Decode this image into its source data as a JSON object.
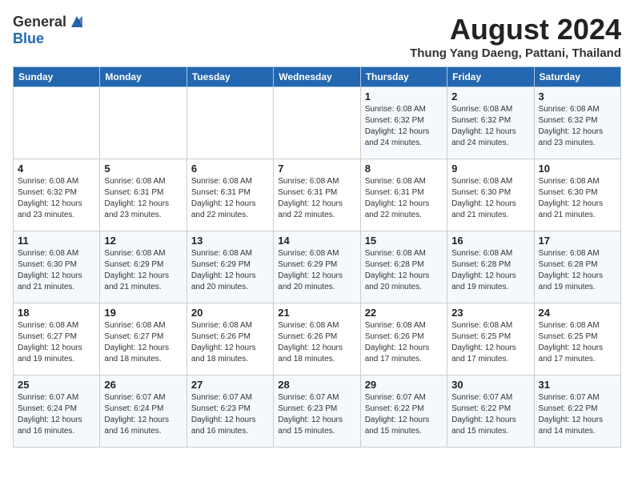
{
  "header": {
    "logo_line1": "General",
    "logo_line2": "Blue",
    "month_year": "August 2024",
    "location": "Thung Yang Daeng, Pattani, Thailand"
  },
  "days_of_week": [
    "Sunday",
    "Monday",
    "Tuesday",
    "Wednesday",
    "Thursday",
    "Friday",
    "Saturday"
  ],
  "weeks": [
    [
      {
        "day": "",
        "info": ""
      },
      {
        "day": "",
        "info": ""
      },
      {
        "day": "",
        "info": ""
      },
      {
        "day": "",
        "info": ""
      },
      {
        "day": "1",
        "info": "Sunrise: 6:08 AM\nSunset: 6:32 PM\nDaylight: 12 hours\nand 24 minutes."
      },
      {
        "day": "2",
        "info": "Sunrise: 6:08 AM\nSunset: 6:32 PM\nDaylight: 12 hours\nand 24 minutes."
      },
      {
        "day": "3",
        "info": "Sunrise: 6:08 AM\nSunset: 6:32 PM\nDaylight: 12 hours\nand 23 minutes."
      }
    ],
    [
      {
        "day": "4",
        "info": "Sunrise: 6:08 AM\nSunset: 6:32 PM\nDaylight: 12 hours\nand 23 minutes."
      },
      {
        "day": "5",
        "info": "Sunrise: 6:08 AM\nSunset: 6:31 PM\nDaylight: 12 hours\nand 23 minutes."
      },
      {
        "day": "6",
        "info": "Sunrise: 6:08 AM\nSunset: 6:31 PM\nDaylight: 12 hours\nand 22 minutes."
      },
      {
        "day": "7",
        "info": "Sunrise: 6:08 AM\nSunset: 6:31 PM\nDaylight: 12 hours\nand 22 minutes."
      },
      {
        "day": "8",
        "info": "Sunrise: 6:08 AM\nSunset: 6:31 PM\nDaylight: 12 hours\nand 22 minutes."
      },
      {
        "day": "9",
        "info": "Sunrise: 6:08 AM\nSunset: 6:30 PM\nDaylight: 12 hours\nand 21 minutes."
      },
      {
        "day": "10",
        "info": "Sunrise: 6:08 AM\nSunset: 6:30 PM\nDaylight: 12 hours\nand 21 minutes."
      }
    ],
    [
      {
        "day": "11",
        "info": "Sunrise: 6:08 AM\nSunset: 6:30 PM\nDaylight: 12 hours\nand 21 minutes."
      },
      {
        "day": "12",
        "info": "Sunrise: 6:08 AM\nSunset: 6:29 PM\nDaylight: 12 hours\nand 21 minutes."
      },
      {
        "day": "13",
        "info": "Sunrise: 6:08 AM\nSunset: 6:29 PM\nDaylight: 12 hours\nand 20 minutes."
      },
      {
        "day": "14",
        "info": "Sunrise: 6:08 AM\nSunset: 6:29 PM\nDaylight: 12 hours\nand 20 minutes."
      },
      {
        "day": "15",
        "info": "Sunrise: 6:08 AM\nSunset: 6:28 PM\nDaylight: 12 hours\nand 20 minutes."
      },
      {
        "day": "16",
        "info": "Sunrise: 6:08 AM\nSunset: 6:28 PM\nDaylight: 12 hours\nand 19 minutes."
      },
      {
        "day": "17",
        "info": "Sunrise: 6:08 AM\nSunset: 6:28 PM\nDaylight: 12 hours\nand 19 minutes."
      }
    ],
    [
      {
        "day": "18",
        "info": "Sunrise: 6:08 AM\nSunset: 6:27 PM\nDaylight: 12 hours\nand 19 minutes."
      },
      {
        "day": "19",
        "info": "Sunrise: 6:08 AM\nSunset: 6:27 PM\nDaylight: 12 hours\nand 18 minutes."
      },
      {
        "day": "20",
        "info": "Sunrise: 6:08 AM\nSunset: 6:26 PM\nDaylight: 12 hours\nand 18 minutes."
      },
      {
        "day": "21",
        "info": "Sunrise: 6:08 AM\nSunset: 6:26 PM\nDaylight: 12 hours\nand 18 minutes."
      },
      {
        "day": "22",
        "info": "Sunrise: 6:08 AM\nSunset: 6:26 PM\nDaylight: 12 hours\nand 17 minutes."
      },
      {
        "day": "23",
        "info": "Sunrise: 6:08 AM\nSunset: 6:25 PM\nDaylight: 12 hours\nand 17 minutes."
      },
      {
        "day": "24",
        "info": "Sunrise: 6:08 AM\nSunset: 6:25 PM\nDaylight: 12 hours\nand 17 minutes."
      }
    ],
    [
      {
        "day": "25",
        "info": "Sunrise: 6:07 AM\nSunset: 6:24 PM\nDaylight: 12 hours\nand 16 minutes."
      },
      {
        "day": "26",
        "info": "Sunrise: 6:07 AM\nSunset: 6:24 PM\nDaylight: 12 hours\nand 16 minutes."
      },
      {
        "day": "27",
        "info": "Sunrise: 6:07 AM\nSunset: 6:23 PM\nDaylight: 12 hours\nand 16 minutes."
      },
      {
        "day": "28",
        "info": "Sunrise: 6:07 AM\nSunset: 6:23 PM\nDaylight: 12 hours\nand 15 minutes."
      },
      {
        "day": "29",
        "info": "Sunrise: 6:07 AM\nSunset: 6:22 PM\nDaylight: 12 hours\nand 15 minutes."
      },
      {
        "day": "30",
        "info": "Sunrise: 6:07 AM\nSunset: 6:22 PM\nDaylight: 12 hours\nand 15 minutes."
      },
      {
        "day": "31",
        "info": "Sunrise: 6:07 AM\nSunset: 6:22 PM\nDaylight: 12 hours\nand 14 minutes."
      }
    ]
  ]
}
